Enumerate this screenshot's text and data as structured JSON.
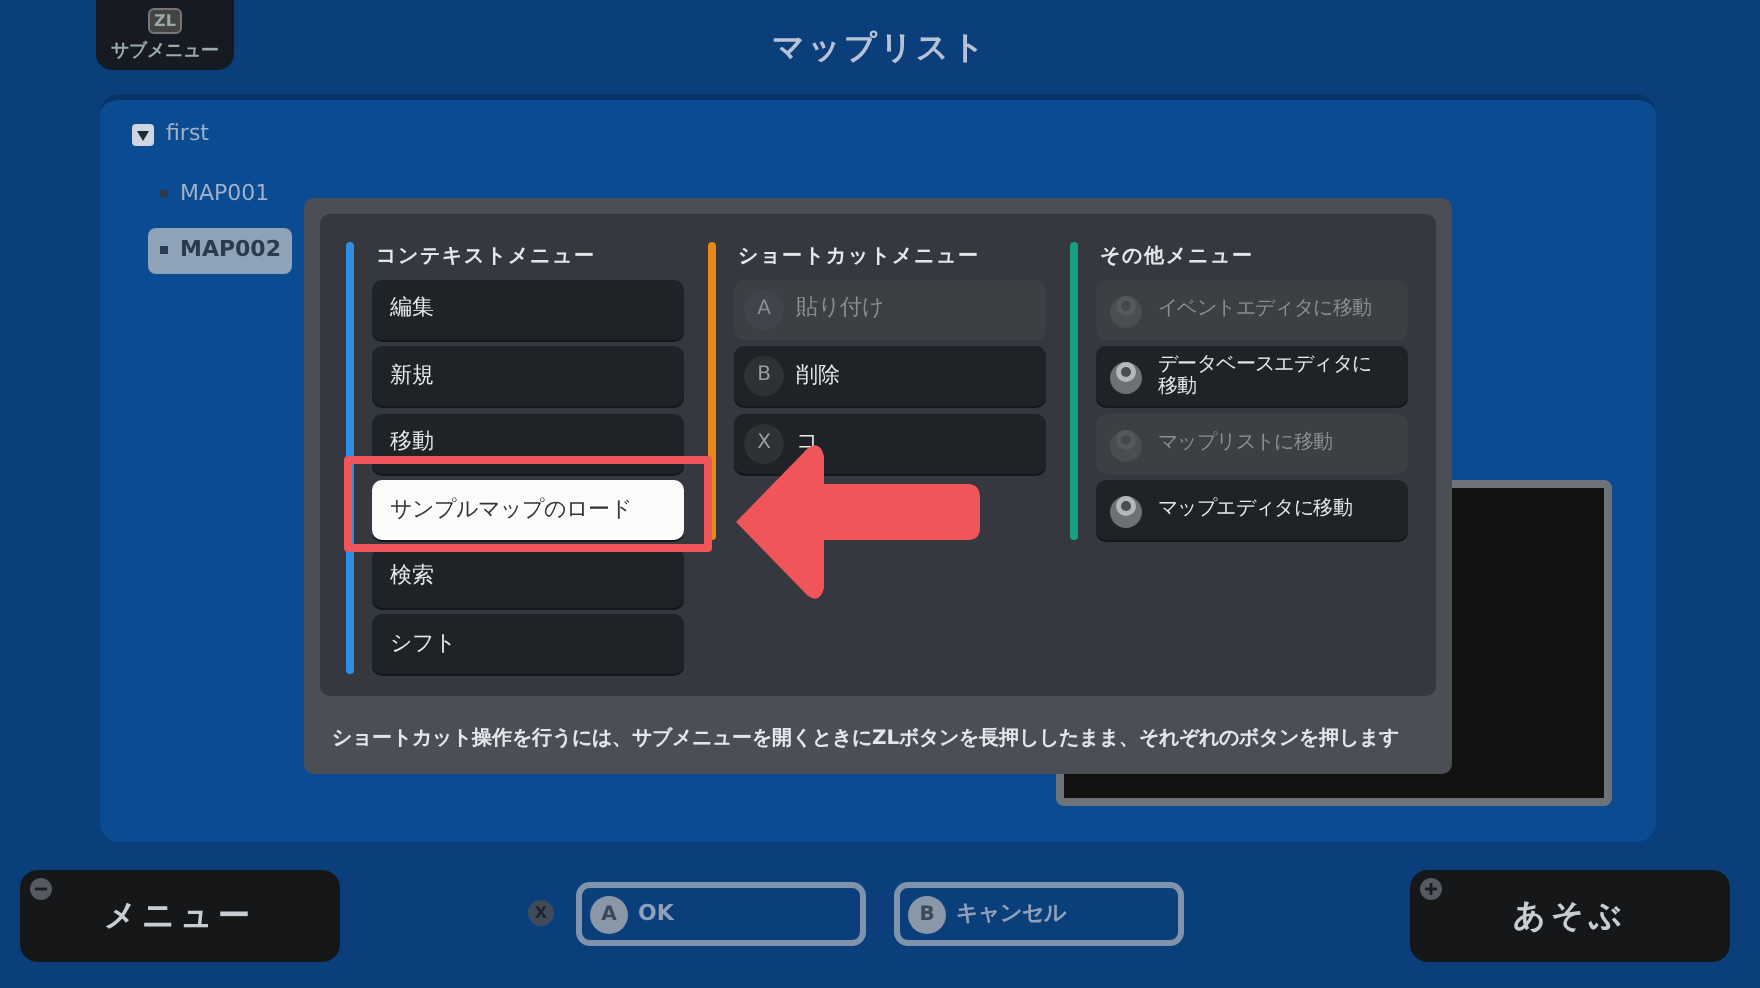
{
  "header": {
    "submenu_key": "ZL",
    "submenu_label": "サブメニュー",
    "title": "マップリスト"
  },
  "tree": [
    {
      "label": "first",
      "expanded": true,
      "selected": false,
      "children": [
        {
          "label": "MAP001",
          "selected": false
        },
        {
          "label": "MAP002",
          "selected": true
        }
      ]
    }
  ],
  "dialog": {
    "columns": [
      {
        "title": "コンテキストメニュー",
        "color": "#2f8ee6",
        "items": [
          {
            "kind": "plain",
            "label": "編集",
            "highlighted": false,
            "disabled": false
          },
          {
            "kind": "plain",
            "label": "新規",
            "highlighted": false,
            "disabled": false
          },
          {
            "kind": "plain",
            "label": "移動",
            "highlighted": false,
            "disabled": false
          },
          {
            "kind": "plain",
            "label": "サンプルマップのロード",
            "highlighted": true,
            "disabled": false
          },
          {
            "kind": "plain",
            "label": "検索",
            "highlighted": false,
            "disabled": false
          },
          {
            "kind": "plain",
            "label": "シフト",
            "highlighted": false,
            "disabled": false
          }
        ]
      },
      {
        "title": "ショートカットメニュー",
        "color": "#e8891c",
        "items": [
          {
            "kind": "key",
            "key": "A",
            "label": "貼り付け",
            "highlighted": false,
            "disabled": true
          },
          {
            "kind": "key",
            "key": "B",
            "label": "削除",
            "highlighted": false,
            "disabled": false
          },
          {
            "kind": "key",
            "key": "X",
            "label": "コ",
            "highlighted": false,
            "disabled": false
          }
        ]
      },
      {
        "title": "その他メニュー",
        "color": "#17a083",
        "items": [
          {
            "kind": "stick",
            "label": "イベントエディタに移動",
            "highlighted": false,
            "disabled": true
          },
          {
            "kind": "stick",
            "label": "データベースエディタに移動",
            "highlighted": false,
            "disabled": false
          },
          {
            "kind": "stick",
            "label": "マップリストに移動",
            "highlighted": false,
            "disabled": true
          },
          {
            "kind": "stick",
            "label": "マップエディタに移動",
            "highlighted": false,
            "disabled": false
          }
        ]
      }
    ],
    "note": "ショートカット操作を行うには、サブメニューを開くときにZLボタンを長押ししたまま、それぞれのボタンを押します"
  },
  "footer": {
    "menu": "メニュー",
    "x_key": "X",
    "ok_key": "A",
    "ok": "OK",
    "cancel_key": "B",
    "cancel": "キャンセル",
    "play": "あそぶ"
  }
}
